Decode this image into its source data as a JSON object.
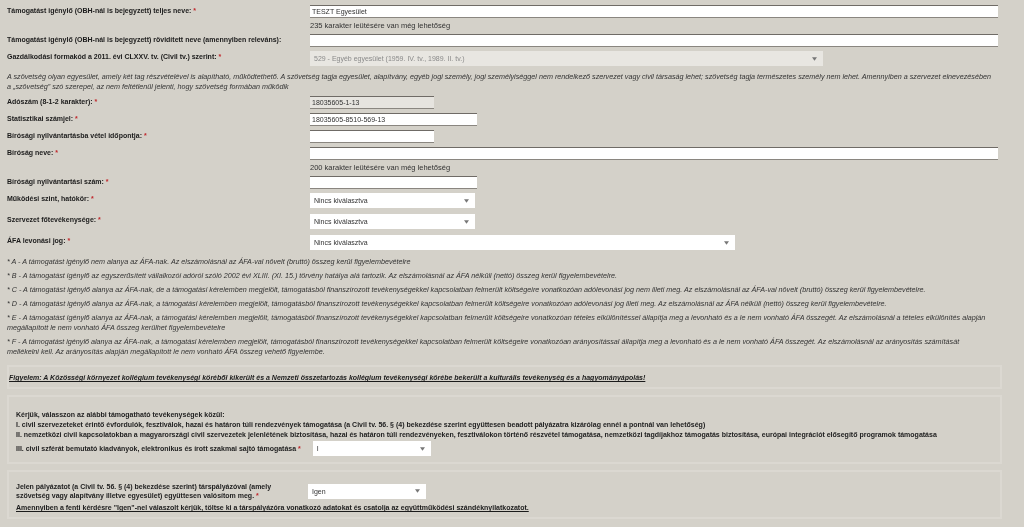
{
  "required_mark": "*",
  "rows": [
    {
      "kind": "text",
      "label": "Támogatást igénylő (OBH-nál is bejegyzett) teljes neve:",
      "required": true,
      "value": "TESZT Egyesület",
      "counter": "235 karakter leütésére van még lehetőség"
    },
    {
      "kind": "text",
      "label": "Támogatást igénylő (OBH-nál is bejegyzett) rövidített neve (amennyiben releváns):",
      "required": false
    },
    {
      "kind": "select",
      "label": "Gazdálkodási formakód a 2011. évi CLXXV. tv. (Civil tv.) szerint:",
      "required": true,
      "value": "529 - Egyéb egyesület (1959. IV. tv., 1989. II. tv.)",
      "disabled": true
    },
    {
      "kind": "note",
      "text": "A szövetség olyan egyesület, amely két tag részvételével is alapítható, működtethető. A szövetség tagja egyesület, alapítvány, egyéb jogi személy, jogi személyiséggel nem rendelkező szervezet vagy civil társaság lehet; szövetség tagja természetes személy nem lehet. Amennyiben a szervezet elnevezésében a „szövetség” szó szerepel, az nem feltétlenül jelenti, hogy szövetség formában működik"
    },
    {
      "kind": "text",
      "label": "Adószám (8-1-2 karakter):",
      "required": true,
      "value": "18035605-1-13",
      "readonly": true
    },
    {
      "kind": "text",
      "label": "Statisztikai számjel:",
      "required": true,
      "value": "18035605-8510-569-13"
    },
    {
      "kind": "text",
      "label": "Bírósági nyilvántartásba vétel időpontja:",
      "required": true
    },
    {
      "kind": "text",
      "label": "Bíróság neve:",
      "required": true,
      "counter": "200 karakter leütésére van még lehetőség"
    },
    {
      "kind": "text",
      "label": "Bírósági nyilvántartási szám:",
      "required": true
    },
    {
      "kind": "select",
      "label": "Működési szint, hatókör:",
      "required": true,
      "value": "Nincs kiválasztva"
    },
    {
      "kind": "select",
      "label": "Szervezet főtevékenysége:",
      "required": true,
      "value": "Nincs kiválasztva"
    },
    {
      "kind": "select",
      "label": "ÁFA levonási jog:",
      "required": true,
      "value": "Nincs kiválasztva"
    }
  ],
  "afa_notes": [
    "* A - A támogatást igénylő nem alanya az ÁFA-nak. Az elszámolásnál az ÁFA-val növelt (bruttó) összeg kerül figyelembevételre",
    "* B - A támogatást igénylő az egyszerűsített vállalkozói adóról szóló 2002 évi XLIII. (XI. 15.) törvény hatálya alá tartozik. Az elszámolásnál az ÁFA nélküli (nettó) összeg kerül figyelembevételre.",
    "* C - A támogatást igénylő alanya az ÁFA-nak, de a támogatási kérelemben megjelölt, támogatásból finanszírozott tevékenységekkel kapcsolatban felmerült költségeire vonatkozóan adólevonási jog nem illeti meg. Az elszámolásnál az ÁFA-val növelt (bruttó) összeg kerül figyelembevételre.",
    "* D - A támogatást igénylő alanya az ÁFA-nak, a támogatási kérelemben megjelölt, támogatásból finanszírozott tevékenységekkel kapcsolatban felmerült költségeire vonatkozóan adólevonási jog illeti meg. Az elszámolásnál az ÁFA nélküli (nettó) összeg kerül figyelembevételre.",
    "* E - A támogatást igénylő alanya az ÁFA-nak, a támogatási kérelemben megjelölt, támogatásból finanszírozott tevékenységekkel kapcsolatban felmerült költségeire vonatkozóan tételes elkülönítéssel állapítja meg a levonható és a le nem vonható ÁFA összegét. Az elszámolásnál a tételes elkülönítés alapján megállapított le nem vonható ÁFA összeg kerülhet figyelembevételre",
    "* F - A támogatást igénylő alanya az ÁFA-nak, a támogatási kérelemben megjelölt, támogatásból finanszírozott tevékenységekkel kapcsolatban felmerült költségeire vonatkozóan arányosítással állapítja meg a levonható és a le nem vonható ÁFA összegét. Az elszámolásnál az arányosítás számítását mellékelni kell. Az arányosítás alapján megállapított le nem vonható ÁFA összeg vehető figyelembe."
  ],
  "notice": "Figyelem: A Közösségi környezet kollégium tevékenységi köréből kikerült és a Nemzeti összetartozás kollégium tevékenységi körébe bekerült a kulturális tevékenység és a hagyományápolás!",
  "activities": {
    "intro": "Kérjük, válasszon az alábbi támogatható tevékenységek közül:",
    "items": [
      "I. civil szervezeteket érintő évfordulók, fesztiválok, hazai és határon túli rendezvények támogatása (a Civil tv. 56. § (4) bekezdése szerint együttesen beadott pályázatra kizárólag ennél a pontnál van lehetőség)",
      "II. nemzetközi civil kapcsolatokban a magyarországi civil szervezetek jelenlétének biztosítása, hazai és határon túli rendezvényeken, fesztiválokon történő részvétel támogatása, nemzetközi tagdíjakhoz támogatás biztosítása, európai integrációt elősegítő programok támogatása",
      "III. civil szférát bemutató kiadványok, elektronikus és írott szakmai sajtó támogatása"
    ],
    "required": true,
    "value": "I"
  },
  "partner": {
    "question": "Jelen pályázatot (a Civil tv. 56. § (4) bekezdése szerint) társpályázóval (amely szövetség vagy alapítvány illetve egyesület) együttesen valósítom meg.",
    "required": true,
    "value": "Igen",
    "note": "Amennyiben a fenti kérdésre \"Igen\"-nel válaszolt kérjük, töltse ki a társpályázóra vonatkozó adatokat és csatolja az együttműködési szándéknyilatkozatot."
  }
}
